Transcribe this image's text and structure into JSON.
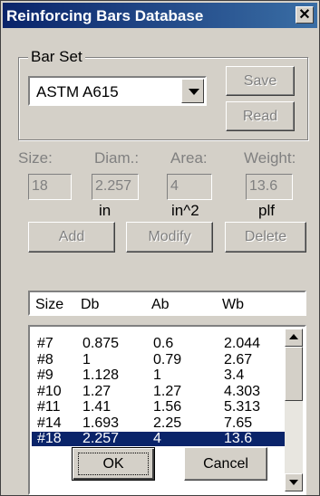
{
  "window": {
    "title": "Reinforcing Bars Database",
    "close_glyph": "✕"
  },
  "bar_set": {
    "group_label": "Bar Set",
    "selected": "ASTM A615",
    "save_label": "Save",
    "read_label": "Read"
  },
  "fields": {
    "size_label": "Size:",
    "diam_label": "Diam.:",
    "area_label": "Area:",
    "weight_label": "Weight:",
    "size_value": "18",
    "diam_value": "2.257",
    "area_value": "4",
    "weight_value": "13.6",
    "diam_unit": "in",
    "area_unit": "in^2",
    "weight_unit": "plf"
  },
  "actions": {
    "add": "Add",
    "modify": "Modify",
    "delete": "Delete"
  },
  "table": {
    "headers": [
      "Size",
      "Db",
      "Ab",
      "Wb"
    ],
    "rows": [
      [
        "#7",
        "0.875",
        "0.6",
        "2.044"
      ],
      [
        "#8",
        "1",
        "0.79",
        "2.67"
      ],
      [
        "#9",
        "1.128",
        "1",
        "3.4"
      ],
      [
        "#10",
        "1.27",
        "1.27",
        "4.303"
      ],
      [
        "#11",
        "1.41",
        "1.56",
        "5.313"
      ],
      [
        "#14",
        "1.693",
        "2.25",
        "7.65"
      ],
      [
        "#18",
        "2.257",
        "4",
        "13.6"
      ]
    ],
    "selected_index": 6
  },
  "footer": {
    "ok": "OK",
    "cancel": "Cancel"
  },
  "colors": {
    "title_bar": "#0a246a",
    "selection": "#0a246a",
    "face": "#d4d0c8"
  },
  "icons": {
    "close": "close-icon",
    "dropdown": "chevron-down-icon",
    "scroll_up": "scroll-up-icon",
    "scroll_down": "scroll-down-icon"
  }
}
